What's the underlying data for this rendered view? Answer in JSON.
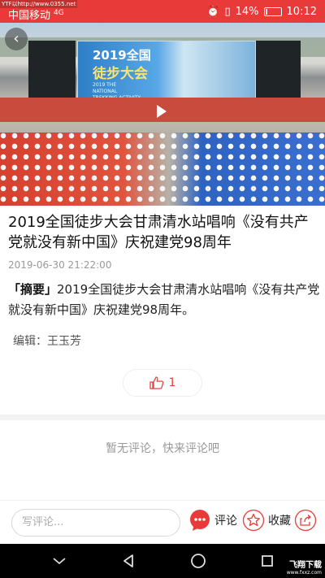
{
  "status_bar": {
    "watermark": "YTF以http://www.0355.net",
    "carrier": "中国移动",
    "signal": "4G",
    "battery": "14%",
    "battery_level": 0.14,
    "time": "10:12"
  },
  "video": {
    "banner_line1": "2019全国",
    "banner_line2": "徒步大会",
    "banner_line3": "2019 THE NATIONAL TREKKING ACTIVITY"
  },
  "article": {
    "title": "2019全国徒步大会甘肃清水站唱响《没有共产党就没有新中国》庆祝建党98周年",
    "date": "2019-06-30 21:22:00",
    "summary_tag": "「摘要」",
    "summary_text": "2019全国徒步大会甘肃清水站唱响《没有共产党就没有新中国》庆祝建党98周年。",
    "editor": "编辑：王玉芳",
    "like_count": "1"
  },
  "comments": {
    "empty_text": "暂无评论，快来评论吧"
  },
  "bottom_bar": {
    "comment_placeholder": "写评论...",
    "comment_label": "评论",
    "favorite_label": "收藏"
  },
  "footer_watermark": {
    "line1": "飞翔下载",
    "line2": "www.fxxz.com"
  },
  "colors": {
    "accent": "#e93a3a"
  }
}
